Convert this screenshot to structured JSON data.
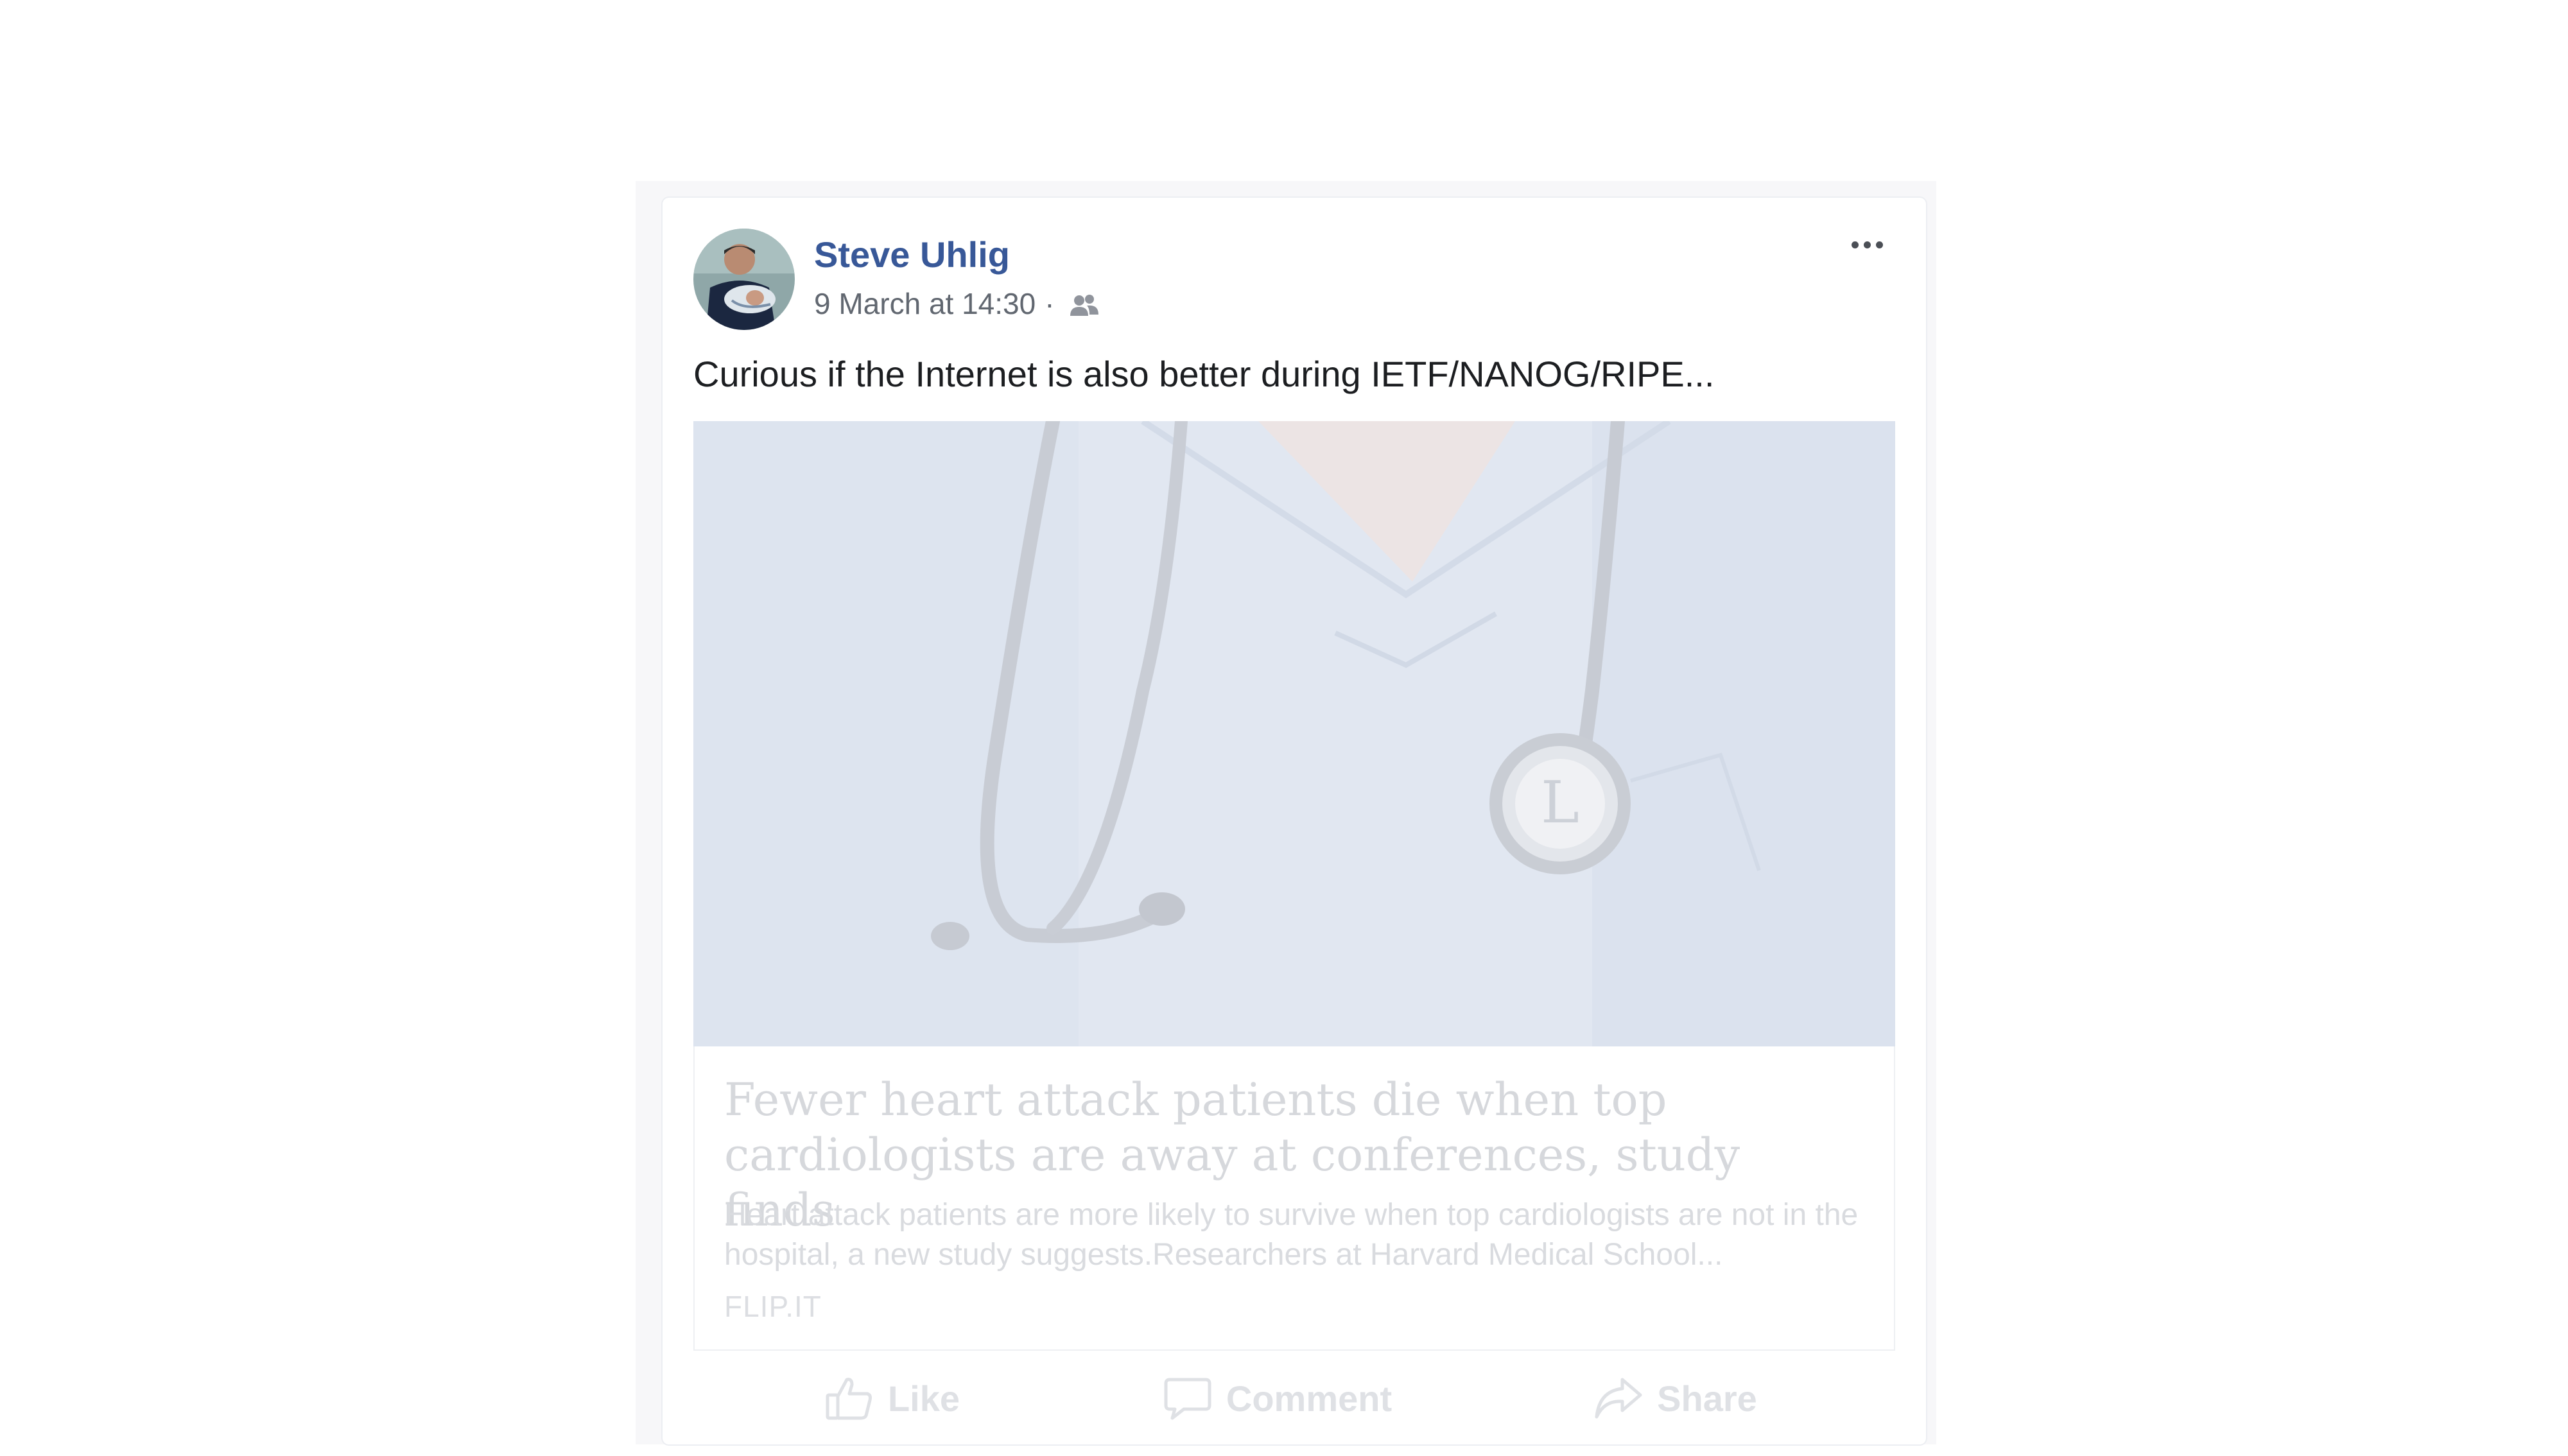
{
  "post": {
    "author_name": "Steve Uhlig",
    "timestamp": "9 March at 14:30",
    "separator": "·",
    "audience_icon": "friends-icon",
    "text": "Curious if the Internet is also better during IETF/NANOG/RIPE...",
    "more_icon": "more-options-icon"
  },
  "link_preview": {
    "title": "Fewer heart attack patients die when top cardiologists are away at conferences, study finds",
    "description": "Heart attack patients are more likely to survive when top cardiologists are not in the hospital, a new study suggests.Researchers at Harvard Medical School...",
    "domain": "FLIP.IT"
  },
  "actions": {
    "like_label": "Like",
    "comment_label": "Comment",
    "share_label": "Share"
  },
  "colors": {
    "author_link": "#385898",
    "text": "#1c1e21",
    "meta": "#616770",
    "faded": "#dfe1e5"
  }
}
